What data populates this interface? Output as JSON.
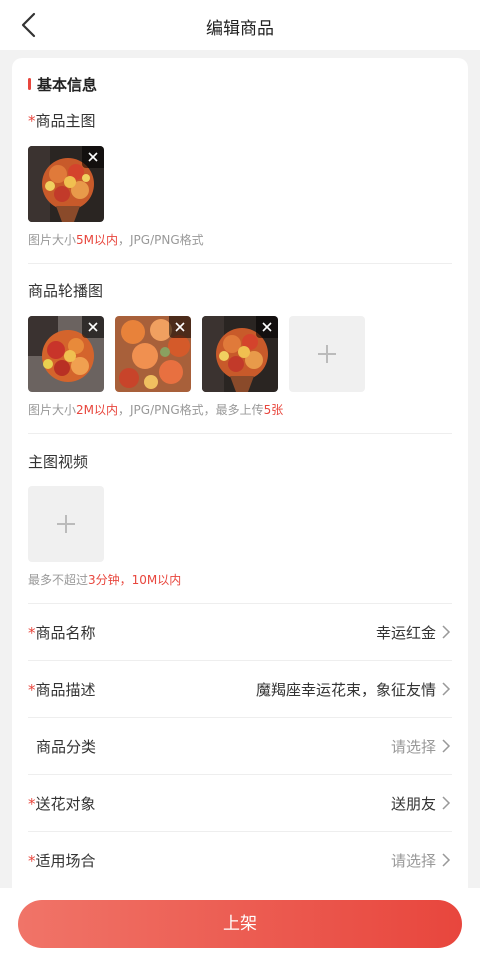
{
  "header": {
    "title": "编辑商品"
  },
  "section": {
    "title": "基本信息"
  },
  "main_image": {
    "required_mark": "*",
    "label": "商品主图",
    "hint_prefix": "图片大小",
    "hint_limit": "5M以内",
    "hint_suffix": "，JPG/PNG格式"
  },
  "carousel": {
    "label": "商品轮播图",
    "hint_prefix": "图片大小",
    "hint_limit": "2M以内",
    "hint_mid": "，JPG/PNG格式，最多上传",
    "hint_count": "5张"
  },
  "video": {
    "label": "主图视频",
    "hint_prefix": "最多不超过",
    "hint_limit": "3分钟，10M以内"
  },
  "fields": [
    {
      "required_mark": "*",
      "label": "商品名称",
      "value": "幸运红金"
    },
    {
      "required_mark": "*",
      "label": "商品描述",
      "value": "魔羯座幸运花束，象征友情"
    },
    {
      "required_mark": "",
      "label": "商品分类",
      "value": "请选择"
    },
    {
      "required_mark": "*",
      "label": "送花对象",
      "value": "送朋友"
    },
    {
      "required_mark": "*",
      "label": "适用场合",
      "value": "请选择"
    }
  ],
  "submit": {
    "label": "上架"
  },
  "colors": {
    "accent": "#e8463d",
    "button_start": "#f07468",
    "button_end": "#e8463d"
  }
}
